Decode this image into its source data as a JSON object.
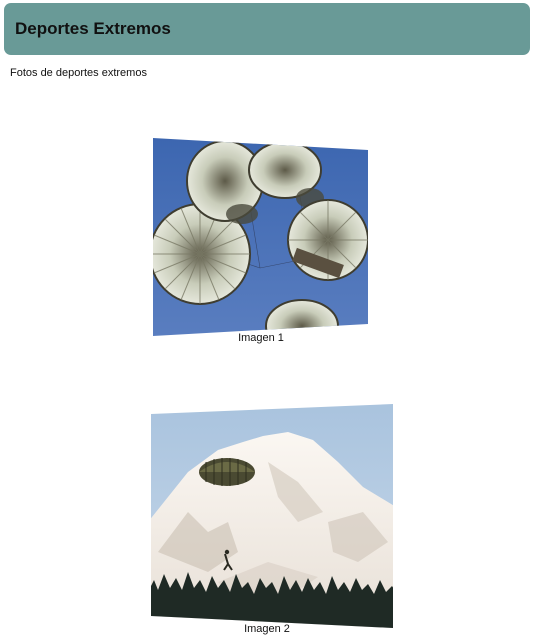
{
  "page": {
    "title": "Deportes Extremos",
    "subtitle": "Fotos de deportes extremos"
  },
  "gallery": {
    "items": [
      {
        "caption": "Imagen 1",
        "image_subject": "parachutes seen from below against blue sky"
      },
      {
        "caption": "Imagen 2",
        "image_subject": "parachutist descending in front of snowy mountain"
      }
    ]
  }
}
